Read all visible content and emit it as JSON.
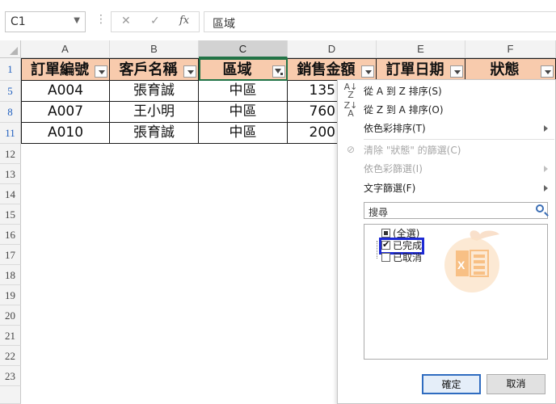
{
  "formula_bar": {
    "name_box": "C1",
    "formula": "區域",
    "fx_label": "fx"
  },
  "columns": [
    "A",
    "B",
    "C",
    "D",
    "E",
    "F"
  ],
  "rows": [
    "1",
    "5",
    "8",
    "11",
    "12",
    "13",
    "14",
    "15",
    "16",
    "17",
    "18",
    "19",
    "20",
    "21",
    "22",
    "23"
  ],
  "table": {
    "headers": [
      "訂單編號",
      "客戶名稱",
      "區域",
      "銷售金額",
      "訂單日期",
      "狀態"
    ],
    "data": [
      [
        "A004",
        "張育誠",
        "中區",
        "135"
      ],
      [
        "A007",
        "王小明",
        "中區",
        "760"
      ],
      [
        "A010",
        "張育誠",
        "中區",
        "200"
      ]
    ]
  },
  "filter_menu": {
    "sort_az": "從 A 到 Z 排序(S)",
    "sort_za": "從 Z 到 A 排序(O)",
    "sort_color": "依色彩排序(T)",
    "clear_filter": "清除 \"狀態\" 的篩選(C)",
    "filter_color": "依色彩篩選(I)",
    "text_filter": "文字篩選(F)",
    "search_placeholder": "搜尋",
    "items": {
      "select_all": "(全選)",
      "completed": "已完成",
      "cancelled": "已取消"
    },
    "ok": "確定",
    "cancel": "取消"
  },
  "colors": {
    "header_fill": "#f8cbad",
    "selection": "#217346",
    "highlight_box": "#1d2ad4"
  }
}
